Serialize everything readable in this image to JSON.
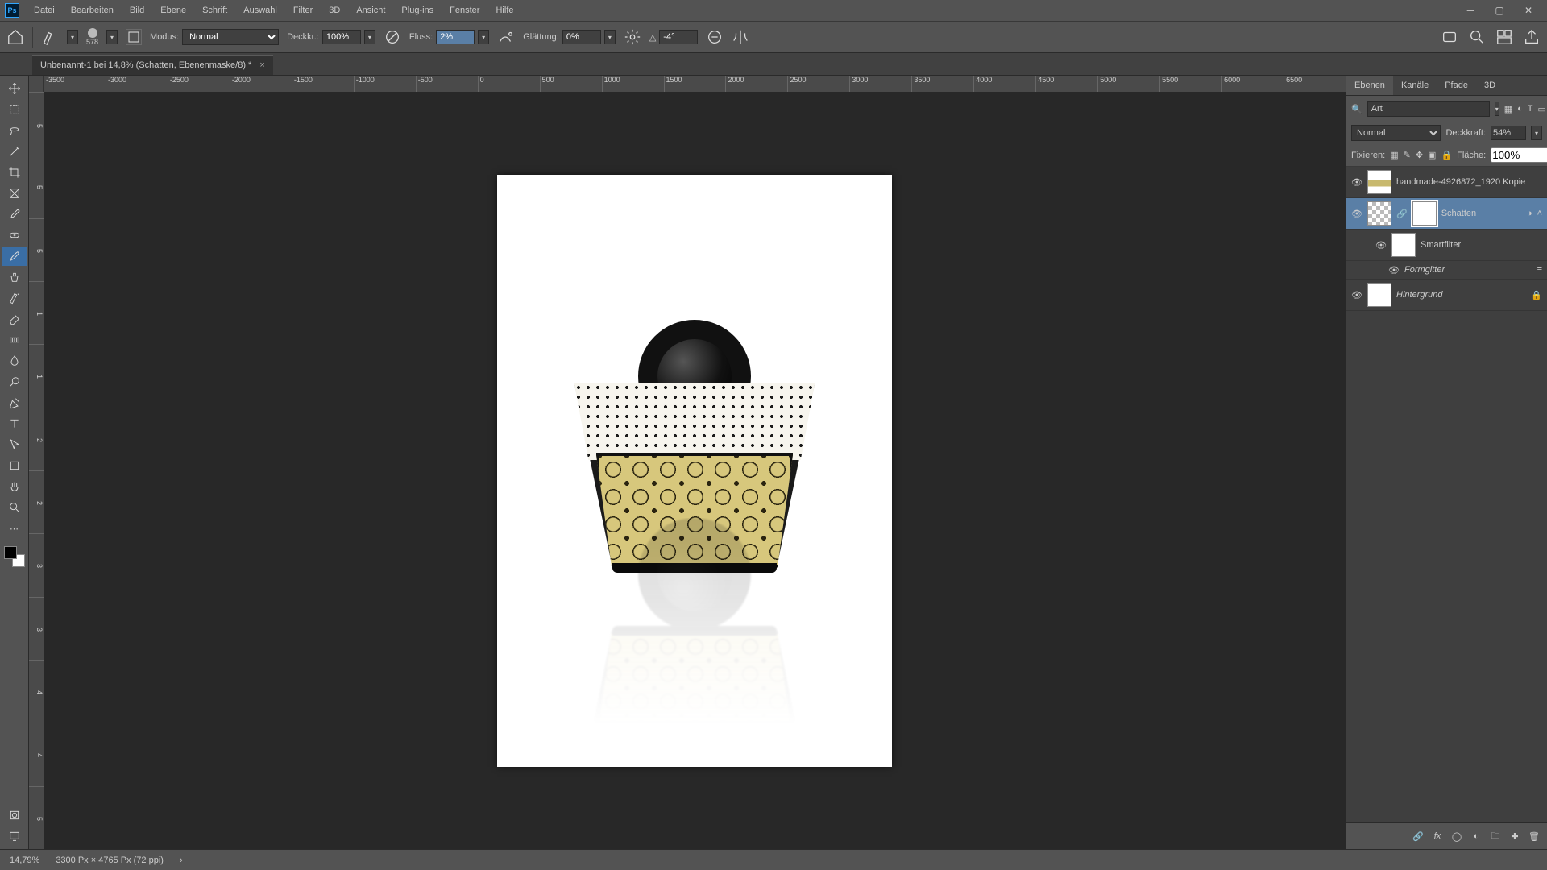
{
  "app": {
    "ps_label": "Ps"
  },
  "menu": [
    "Datei",
    "Bearbeiten",
    "Bild",
    "Ebene",
    "Schrift",
    "Auswahl",
    "Filter",
    "3D",
    "Ansicht",
    "Plug-ins",
    "Fenster",
    "Hilfe"
  ],
  "options": {
    "brush_size": "578",
    "mode_label": "Modus:",
    "mode_value": "Normal",
    "opacity_label": "Deckkr.:",
    "opacity_value": "100%",
    "flow_label": "Fluss:",
    "flow_value": "2%",
    "smoothing_label": "Glättung:",
    "smoothing_value": "0%",
    "angle_icon": "△",
    "angle_value": "-4°"
  },
  "doc_tab": {
    "title": "Unbenannt-1 bei 14,8% (Schatten, Ebenenmaske/8) *"
  },
  "ruler_h": [
    "-3500",
    "-3000",
    "-2500",
    "-2000",
    "-1500",
    "-1000",
    "-500",
    "0",
    "500",
    "1000",
    "1500",
    "2000",
    "2500",
    "3000",
    "3500",
    "4000",
    "4500",
    "5000",
    "5500",
    "6000",
    "6500"
  ],
  "ruler_v": [
    "-5",
    "0",
    "5",
    "0",
    "5",
    "0",
    "1",
    "0",
    "1",
    "5",
    "2",
    "0",
    "2",
    "5",
    "3",
    "0",
    "3",
    "5",
    "4",
    "0",
    "4",
    "5",
    "5",
    "0"
  ],
  "panel_tabs": {
    "layers": "Ebenen",
    "channels": "Kanäle",
    "paths": "Pfade",
    "threed": "3D"
  },
  "layers_search_placeholder": "Art",
  "blend": {
    "mode": "Normal",
    "opacity_label": "Deckkraft:",
    "opacity_value": "54%"
  },
  "lock": {
    "label": "Fixieren:",
    "fill_label": "Fläche:",
    "fill_value": "100%"
  },
  "layer_items": {
    "l0": "handmade-4926872_1920 Kopie",
    "l1": "Schatten",
    "l2": "Smartfilter",
    "l3": "Formgitter",
    "l4": "Hintergrund"
  },
  "status": {
    "zoom": "14,79%",
    "docinfo": "3300 Px × 4765 Px (72 ppi)"
  }
}
